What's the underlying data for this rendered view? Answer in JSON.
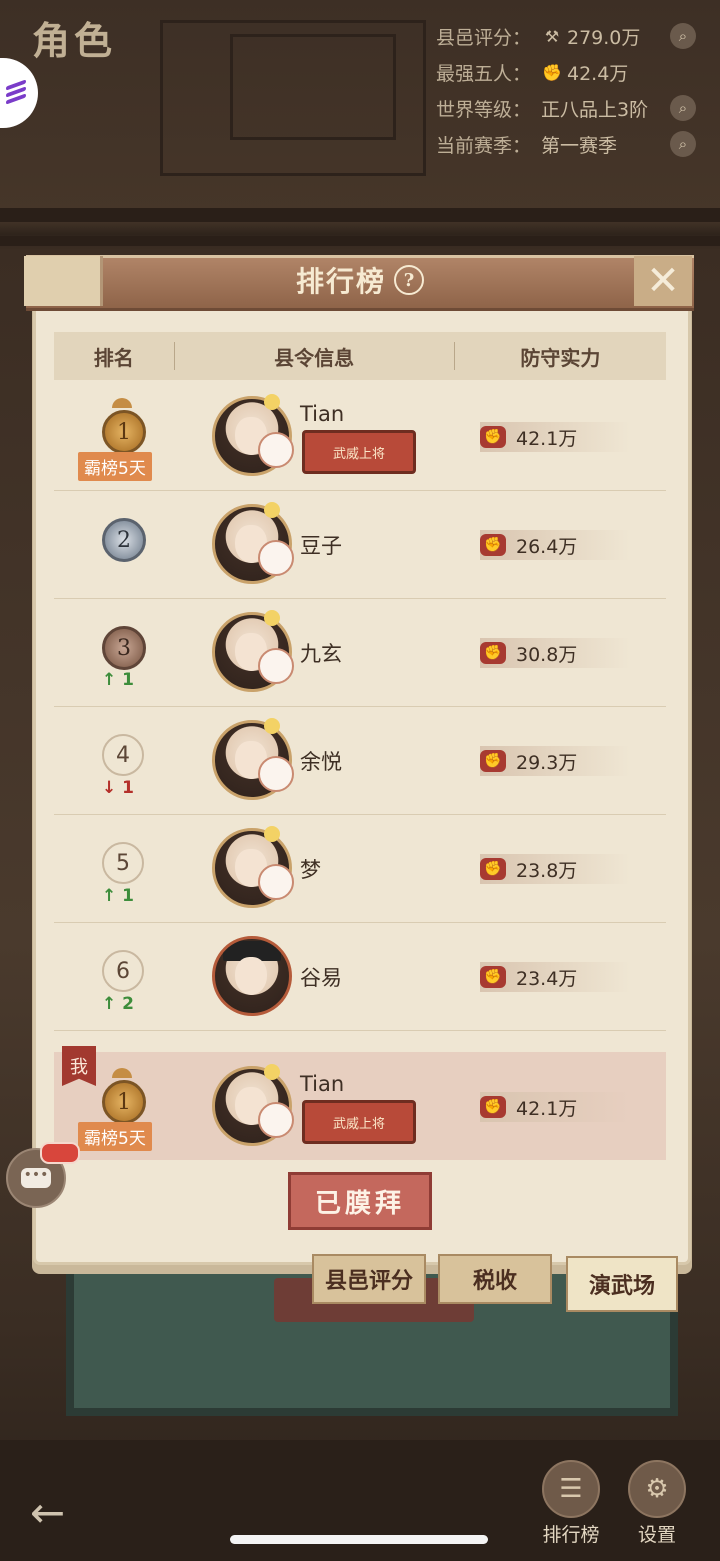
{
  "top": {
    "title": "角色",
    "stats": [
      {
        "label": "县邑评分：",
        "icon": "hammer-icon",
        "value": "279.0万",
        "has_search": true
      },
      {
        "label": "最强五人：",
        "icon": "fist-icon",
        "value": "42.4万",
        "has_search": false
      },
      {
        "label": "世界等级：",
        "icon": "",
        "value": "正八品上3阶",
        "has_search": true
      },
      {
        "label": "当前赛季：",
        "icon": "",
        "value": "第一赛季",
        "has_search": true
      }
    ]
  },
  "panel": {
    "title": "排行榜",
    "help_glyph": "?",
    "close_glyph": "✕",
    "columns": [
      "排名",
      "县令信息",
      "防守实力"
    ],
    "rows": [
      {
        "rank": "1",
        "medal": "gold",
        "badge": "霸榜5天",
        "trend_dir": "",
        "trend": "",
        "name": "Tian",
        "title_badge": "武威上将",
        "power": "42.1万",
        "avatar": "female"
      },
      {
        "rank": "2",
        "medal": "silver",
        "badge": "",
        "trend_dir": "",
        "trend": "",
        "name": "豆子",
        "title_badge": "",
        "power": "26.4万",
        "avatar": "female"
      },
      {
        "rank": "3",
        "medal": "bronze",
        "badge": "",
        "trend_dir": "up",
        "trend": "↑ 1",
        "name": "九玄",
        "title_badge": "",
        "power": "30.8万",
        "avatar": "female"
      },
      {
        "rank": "4",
        "medal": "plain",
        "badge": "",
        "trend_dir": "down",
        "trend": "↓ 1",
        "name": "余悦",
        "title_badge": "",
        "power": "29.3万",
        "avatar": "female"
      },
      {
        "rank": "5",
        "medal": "plain",
        "badge": "",
        "trend_dir": "up",
        "trend": "↑ 1",
        "name": "梦",
        "title_badge": "",
        "power": "23.8万",
        "avatar": "female"
      },
      {
        "rank": "6",
        "medal": "plain",
        "badge": "",
        "trend_dir": "up",
        "trend": "↑ 2",
        "name": "谷易",
        "title_badge": "",
        "power": "23.4万",
        "avatar": "official"
      }
    ],
    "me": {
      "flag": "我",
      "rank": "1",
      "medal": "gold",
      "badge": "霸榜5天",
      "name": "Tian",
      "title_badge": "武威上将",
      "power": "42.1万"
    },
    "worship_button": "已膜拜",
    "tabs": [
      {
        "label": "县邑评分",
        "active": false
      },
      {
        "label": "税收",
        "active": false
      },
      {
        "label": "演武场",
        "active": true
      }
    ]
  },
  "chat": {
    "bubble": "•••"
  },
  "bottom_nav": {
    "back_glyph": "←",
    "items": [
      {
        "label": "排行榜",
        "icon": "leaderboard-icon"
      },
      {
        "label": "设置",
        "icon": "gear-icon"
      }
    ]
  }
}
